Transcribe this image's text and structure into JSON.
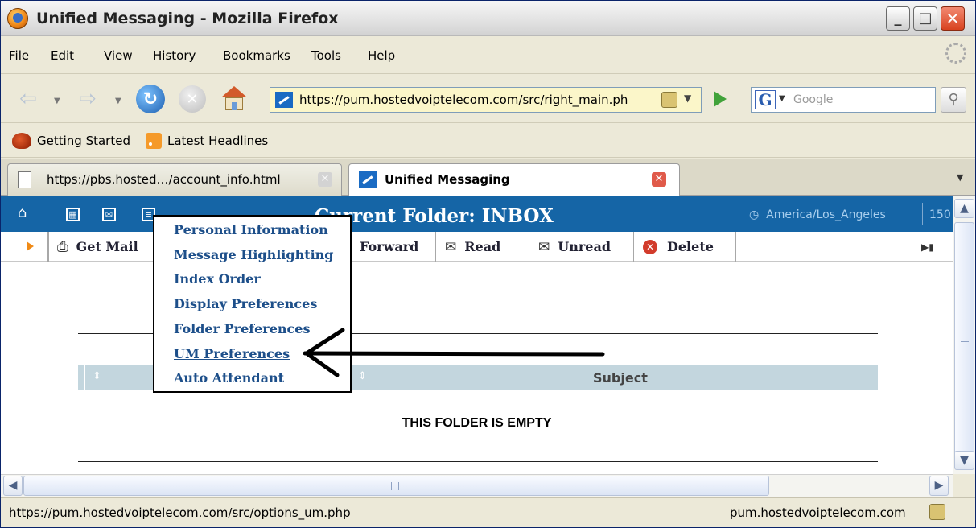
{
  "window": {
    "title": "Unified Messaging - Mozilla Firefox",
    "min_glyph": "_",
    "max_glyph": "□",
    "close_glyph": "✕"
  },
  "menubar": {
    "items": [
      "File",
      "Edit",
      "View",
      "History",
      "Bookmarks",
      "Tools",
      "Help"
    ]
  },
  "navbar": {
    "back_glyph": "⇦",
    "forward_glyph": "⇨",
    "reload_glyph": "↻",
    "stop_glyph": "✕",
    "url": "https://pum.hostedvoiptelecom.com/src/right_main.ph",
    "search_engine_glyph": "G",
    "search_placeholder": "Google",
    "search_button_glyph": "⚲"
  },
  "bookmarks": {
    "items": [
      "Getting Started",
      "Latest Headlines"
    ]
  },
  "tabs": [
    {
      "label": "https://pbs.hosted…/account_info.html",
      "active": false
    },
    {
      "label": "Unified Messaging",
      "active": true
    }
  ],
  "app": {
    "folder_title": "Current Folder: INBOX",
    "timezone": "America/Los_Angeles",
    "number_fragment": "150",
    "actions": {
      "get_mail": "Get Mail",
      "forward": "Forward",
      "read": "Read",
      "unread": "Unread",
      "delete": "Delete"
    },
    "column_subject": "Subject",
    "empty_message": "THIS FOLDER IS EMPTY",
    "header_icons": [
      "home-icon",
      "contacts-icon",
      "mail-icon",
      "options-icon"
    ]
  },
  "options_menu": {
    "items": [
      "Personal Information",
      "Message Highlighting",
      "Index Order",
      "Display Preferences",
      "Folder Preferences",
      "UM Preferences",
      "Auto Attendant"
    ],
    "highlighted": "UM Preferences"
  },
  "statusbar": {
    "url": "https://pum.hostedvoiptelecom.com/src/options_um.php",
    "host": "pum.hostedvoiptelecom.com"
  },
  "colors": {
    "app_header": "#1565a6",
    "menu_link": "#1d4f8a",
    "column_header": "#c3d6de"
  }
}
